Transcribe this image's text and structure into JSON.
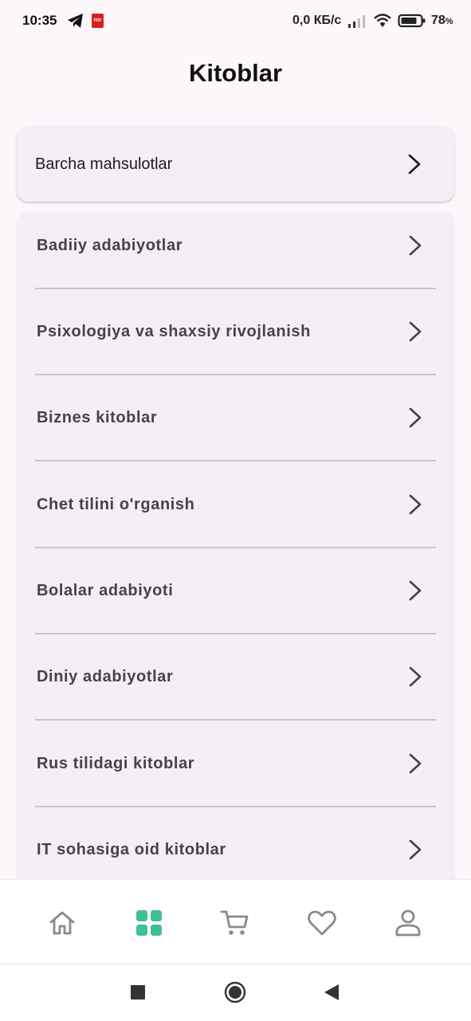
{
  "status_bar": {
    "time": "10:35",
    "network_speed": "0,0 КБ/с",
    "battery": "78",
    "battery_suffix": "%",
    "icons": [
      "telegram-icon",
      "pdf-icon",
      "signal-icon",
      "wifi-icon",
      "battery-icon"
    ],
    "pdf_label": "PDF"
  },
  "header": {
    "title": "Kitoblar"
  },
  "all_products": {
    "label": "Barcha mahsulotlar"
  },
  "categories": [
    {
      "label": "Badiiy adabiyotlar"
    },
    {
      "label": "Psixologiya va shaxsiy rivojlanish"
    },
    {
      "label": "Biznes kitoblar"
    },
    {
      "label": "Chet tilini o'rganish"
    },
    {
      "label": "Bolalar adabiyoti"
    },
    {
      "label": "Diniy adabiyotlar"
    },
    {
      "label": "Rus tilidagi kitoblar"
    },
    {
      "label": "IT sohasiga oid kitoblar"
    }
  ],
  "bottom_nav": {
    "items": [
      "home-icon",
      "categories-icon",
      "cart-icon",
      "favorites-icon",
      "profile-icon"
    ],
    "active": "categories-icon"
  },
  "colors": {
    "background": "#fdf7fc",
    "card": "#f4eff6",
    "accent": "#3fbf95",
    "nav_icon": "#8a8a8a",
    "divider": "#c8c3d0"
  }
}
